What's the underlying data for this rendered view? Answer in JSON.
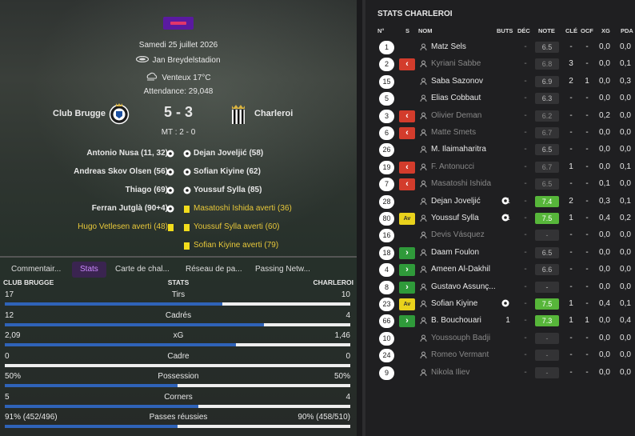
{
  "match": {
    "date": "Samedi 25 juillet 2026",
    "stadium": "Jan Breydelstadion",
    "weather": "Venteux 17°C",
    "attendance": "Attendance: 29,048",
    "home_team": "Club Brugge",
    "away_team": "Charleroi",
    "score": "5 - 3",
    "halftime": "MT : 2 - 0"
  },
  "events": [
    {
      "home": "Antonio Nusa (11, 32)",
      "home_type": "goal",
      "away": "Dejan Joveljić (58)",
      "away_type": "goal"
    },
    {
      "home": "Andreas Skov Olsen (56)",
      "home_type": "goal",
      "away": "Sofian Kiyine (62)",
      "away_type": "goal"
    },
    {
      "home": "Thiago (69)",
      "home_type": "goal",
      "away": "Youssuf Sylla (85)",
      "away_type": "goal"
    },
    {
      "home": "Ferran Jutglà (90+4)",
      "home_type": "goal",
      "away": "Masatoshi Ishida averti (36)",
      "away_type": "card"
    },
    {
      "home": "Hugo Vetlesen averti (48)",
      "home_type": "card",
      "away": "Youssuf Sylla averti (60)",
      "away_type": "card"
    },
    {
      "home": "",
      "home_type": "",
      "away": "Sofian Kiyine averti (79)",
      "away_type": "card"
    }
  ],
  "tabs": [
    "Commentair...",
    "Stats",
    "Carte de chal...",
    "Réseau de pa...",
    "Passing Netw..."
  ],
  "stats_header": {
    "home": "CLUB BRUGGE",
    "center": "STATS",
    "away": "CHARLEROI"
  },
  "stats": [
    {
      "label": "Tirs",
      "home": "17",
      "away": "10",
      "home_share": 0.63
    },
    {
      "label": "Cadrés",
      "home": "12",
      "away": "4",
      "home_share": 0.75
    },
    {
      "label": "xG",
      "home": "2,09",
      "away": "1,46",
      "home_share": 0.67
    },
    {
      "label": "Cadre",
      "home": "0",
      "away": "0",
      "home_share": 0.0
    },
    {
      "label": "Possession",
      "home": "50%",
      "away": "50%",
      "home_share": 0.5
    },
    {
      "label": "Corners",
      "home": "5",
      "away": "4",
      "home_share": 0.56
    },
    {
      "label": "Passes réussies",
      "home": "91% (452/496)",
      "away": "90% (458/510)",
      "home_share": 0.5
    }
  ],
  "right_panel": {
    "title": "STATS CHARLEROI",
    "columns": {
      "num": "N°",
      "s": "S",
      "nom": "NOM",
      "buts": "BUTS",
      "dec": "DÉC",
      "note": "NOTE",
      "cle": "CLÉ",
      "ocf": "OCF",
      "xg": "XG",
      "pda": "PDA"
    },
    "players": [
      {
        "num": "1",
        "sub": "",
        "name": "Matz Sels",
        "dim": false,
        "goal_icon": false,
        "buts": "",
        "dec": "-",
        "note": "6.5",
        "note_good": false,
        "cle": "-",
        "ocf": "-",
        "xg": "0,0",
        "pda": "0,0"
      },
      {
        "num": "2",
        "sub": "out",
        "name": "Kyriani Sabbe",
        "dim": true,
        "goal_icon": false,
        "buts": "",
        "dec": "-",
        "note": "6.8",
        "note_good": false,
        "cle": "3",
        "ocf": "-",
        "xg": "0,0",
        "pda": "0,1"
      },
      {
        "num": "15",
        "sub": "",
        "name": "Saba Sazonov",
        "dim": false,
        "goal_icon": false,
        "buts": "",
        "dec": "-",
        "note": "6.9",
        "note_good": false,
        "cle": "2",
        "ocf": "1",
        "xg": "0,0",
        "pda": "0,3"
      },
      {
        "num": "5",
        "sub": "",
        "name": "Elias Cobbaut",
        "dim": false,
        "goal_icon": false,
        "buts": "",
        "dec": "-",
        "note": "6.3",
        "note_good": false,
        "cle": "-",
        "ocf": "-",
        "xg": "0,0",
        "pda": "0,0"
      },
      {
        "num": "3",
        "sub": "out",
        "name": "Olivier Deman",
        "dim": true,
        "goal_icon": false,
        "buts": "",
        "dec": "-",
        "note": "6.2",
        "note_good": false,
        "cle": "-",
        "ocf": "-",
        "xg": "0,2",
        "pda": "0,0"
      },
      {
        "num": "6",
        "sub": "out",
        "name": "Matte Smets",
        "dim": true,
        "goal_icon": false,
        "buts": "",
        "dec": "-",
        "note": "6.7",
        "note_good": false,
        "cle": "-",
        "ocf": "-",
        "xg": "0,0",
        "pda": "0,0"
      },
      {
        "num": "26",
        "sub": "",
        "name": "M. Ilaimaharitra",
        "dim": false,
        "goal_icon": false,
        "buts": "",
        "dec": "-",
        "note": "6.5",
        "note_good": false,
        "cle": "-",
        "ocf": "-",
        "xg": "0,0",
        "pda": "0,0"
      },
      {
        "num": "19",
        "sub": "out",
        "name": "F. Antonucci",
        "dim": true,
        "goal_icon": false,
        "buts": "",
        "dec": "-",
        "note": "6.7",
        "note_good": false,
        "cle": "1",
        "ocf": "-",
        "xg": "0,0",
        "pda": "0,1"
      },
      {
        "num": "7",
        "sub": "out",
        "name": "Masatoshi Ishida",
        "dim": true,
        "goal_icon": false,
        "buts": "",
        "dec": "-",
        "note": "6.5",
        "note_good": false,
        "cle": "-",
        "ocf": "-",
        "xg": "0,1",
        "pda": "0,0"
      },
      {
        "num": "28",
        "sub": "",
        "name": "Dejan Joveljić",
        "dim": false,
        "goal_icon": true,
        "buts": "1",
        "dec": "-",
        "note": "7.4",
        "note_good": true,
        "cle": "2",
        "ocf": "-",
        "xg": "0,3",
        "pda": "0,1"
      },
      {
        "num": "80",
        "sub": "av",
        "name": "Youssuf Sylla",
        "dim": false,
        "goal_icon": true,
        "buts": "1",
        "dec": "-",
        "note": "7.5",
        "note_good": true,
        "cle": "1",
        "ocf": "-",
        "xg": "0,4",
        "pda": "0,2"
      },
      {
        "num": "16",
        "sub": "",
        "name": "Devis Vásquez",
        "dim": true,
        "goal_icon": false,
        "buts": "",
        "dec": "-",
        "note": "-",
        "note_good": false,
        "cle": "-",
        "ocf": "-",
        "xg": "0,0",
        "pda": "0,0"
      },
      {
        "num": "18",
        "sub": "in",
        "name": "Daam Foulon",
        "dim": false,
        "goal_icon": false,
        "buts": "",
        "dec": "-",
        "note": "6.5",
        "note_good": false,
        "cle": "-",
        "ocf": "-",
        "xg": "0,0",
        "pda": "0,0"
      },
      {
        "num": "4",
        "sub": "in",
        "name": "Ameen Al-Dakhil",
        "dim": false,
        "goal_icon": false,
        "buts": "",
        "dec": "-",
        "note": "6.6",
        "note_good": false,
        "cle": "-",
        "ocf": "-",
        "xg": "0,0",
        "pda": "0,0"
      },
      {
        "num": "8",
        "sub": "in",
        "name": "Gustavo Assunç...",
        "dim": false,
        "goal_icon": false,
        "buts": "",
        "dec": "-",
        "note": "-",
        "note_good": false,
        "cle": "-",
        "ocf": "-",
        "xg": "0,0",
        "pda": "0,0"
      },
      {
        "num": "23",
        "sub": "av",
        "name": "Sofian Kiyine",
        "dim": false,
        "goal_icon": true,
        "buts": "",
        "dec": "-",
        "note": "7.5",
        "note_good": true,
        "cle": "1",
        "ocf": "-",
        "xg": "0,4",
        "pda": "0,1"
      },
      {
        "num": "66",
        "sub": "in",
        "name": "B. Bouchouari",
        "dim": false,
        "goal_icon": false,
        "buts": "1",
        "dec": "-",
        "note": "7.3",
        "note_good": true,
        "cle": "1",
        "ocf": "1",
        "xg": "0,0",
        "pda": "0,4"
      },
      {
        "num": "10",
        "sub": "",
        "name": "Youssouph Badji",
        "dim": true,
        "goal_icon": false,
        "buts": "",
        "dec": "-",
        "note": "-",
        "note_good": false,
        "cle": "-",
        "ocf": "-",
        "xg": "0,0",
        "pda": "0,0"
      },
      {
        "num": "24",
        "sub": "",
        "name": "Romeo Vermant",
        "dim": true,
        "goal_icon": false,
        "buts": "",
        "dec": "-",
        "note": "-",
        "note_good": false,
        "cle": "-",
        "ocf": "-",
        "xg": "0,0",
        "pda": "0,0"
      },
      {
        "num": "9",
        "sub": "",
        "name": "Nikola Iliev",
        "dim": true,
        "goal_icon": false,
        "buts": "",
        "dec": "-",
        "note": "-",
        "note_good": false,
        "cle": "-",
        "ocf": "-",
        "xg": "0,0",
        "pda": "0,0"
      }
    ],
    "av_label": "Av"
  },
  "colors": {
    "accent": "#cc88ff",
    "bar_fill": "#2f63b8",
    "card": "#f2dc1c",
    "sub_out": "#d33c2c",
    "sub_in": "#2f9a3a",
    "note_good": "#57b63a"
  }
}
